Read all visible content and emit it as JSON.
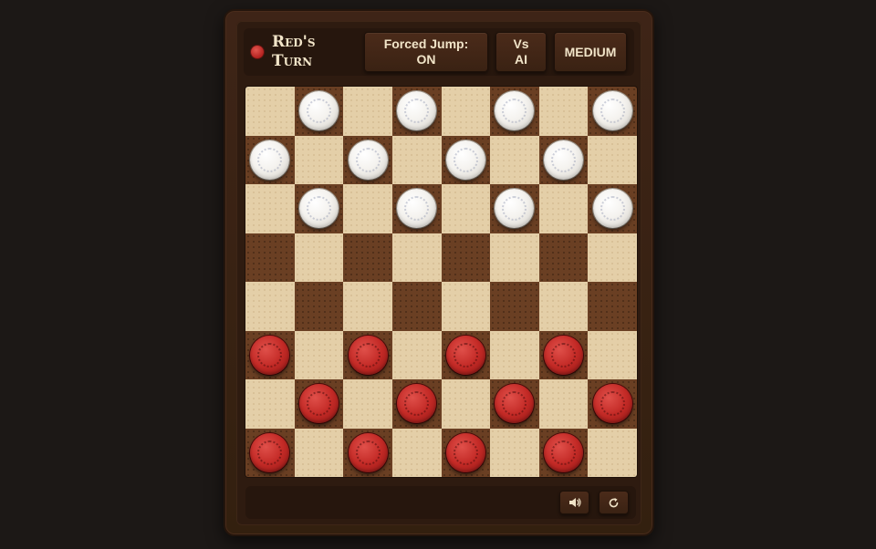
{
  "status": {
    "turn_label": "Red's Turn",
    "turn_color": "#c32a26"
  },
  "controls": {
    "forced_jump_line1": "Forced Jump:",
    "forced_jump_line2": "ON",
    "mode_line1": "Vs",
    "mode_line2": "AI",
    "difficulty": "MEDIUM"
  },
  "board": {
    "size": 8,
    "light_color": "#e4cfa8",
    "dark_color": "#6a3f23",
    "rows": [
      "-w-w-w-w",
      "w-w-w-w-",
      "-w-w-w-w",
      "--------",
      "--------",
      "r-r-r-r-",
      "-r-r-r-r",
      "r-r-r-r-"
    ]
  },
  "footer": {
    "sound_icon": "speaker-icon",
    "restart_icon": "restart-icon"
  },
  "colors": {
    "red_piece": "#c32a26",
    "white_piece": "#f4f2ee",
    "frame": "#3e2417"
  }
}
